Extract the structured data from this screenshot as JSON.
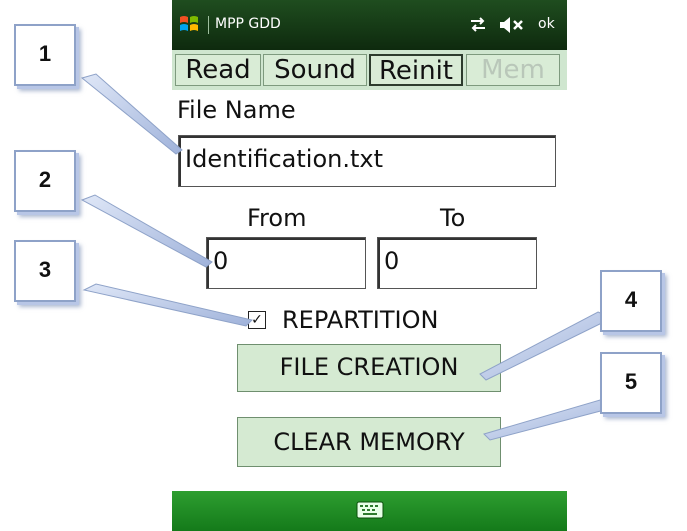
{
  "status_bar": {
    "app_title": "MPP GDD",
    "ok_label": "ok",
    "icons": [
      "windows-start-icon",
      "connectivity-icon",
      "speaker-muted-icon"
    ]
  },
  "tabs": [
    {
      "label": "Read",
      "state": "normal"
    },
    {
      "label": "Sound",
      "state": "normal"
    },
    {
      "label": "Reinit",
      "state": "active"
    },
    {
      "label": "Mem",
      "state": "disabled"
    }
  ],
  "file": {
    "label": "File Name",
    "value": "Identification.txt"
  },
  "range": {
    "from_label": "From",
    "to_label": "To",
    "from_value": "0",
    "to_value": "0"
  },
  "repartition": {
    "checked": true,
    "check_mark": "✓",
    "label": "REPARTITION"
  },
  "buttons": {
    "file_creation": "FILE CREATION",
    "clear_memory": "CLEAR MEMORY"
  },
  "bottom_bar": {
    "icons": [
      "keyboard-icon"
    ]
  },
  "callouts": [
    "1",
    "2",
    "3",
    "4",
    "5"
  ],
  "colors": {
    "status_bar": "#0e2a0e",
    "tab_background": "#d9ecd6",
    "button_background": "#d5ead2",
    "bottom_bar": "#147a1a",
    "callout_border": "#8ea2c8"
  }
}
